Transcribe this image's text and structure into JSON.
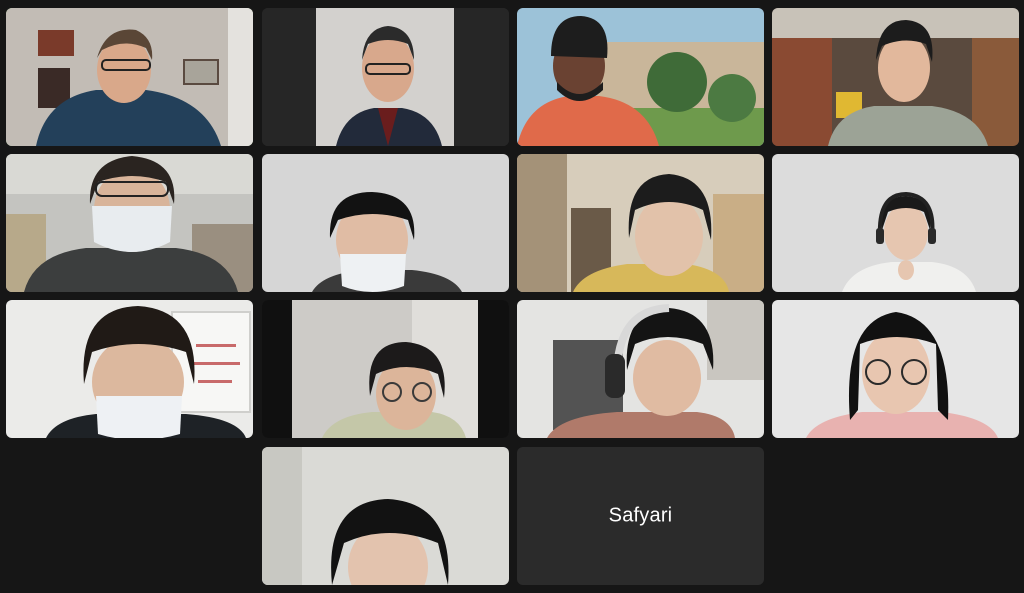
{
  "meeting": {
    "layout": "gallery-view",
    "participant_count": 14,
    "active_speaker_color": "#6fd36b"
  },
  "participants": [
    {
      "video": true
    },
    {
      "video": true
    },
    {
      "video": true
    },
    {
      "video": true
    },
    {
      "video": true
    },
    {
      "video": true
    },
    {
      "video": true
    },
    {
      "video": true
    },
    {
      "video": true
    },
    {
      "video": true
    },
    {
      "video": true
    },
    {
      "video": true
    },
    {
      "video": true
    },
    {
      "video": false,
      "name": "Safyari"
    }
  ]
}
